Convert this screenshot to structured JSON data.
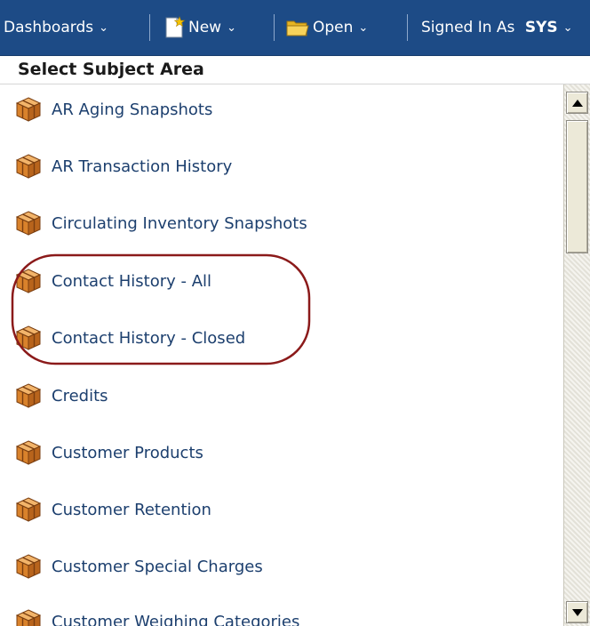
{
  "toolbar": {
    "dashboards_label": "Dashboards",
    "new_label": "New",
    "open_label": "Open",
    "signed_in_label": "Signed In As",
    "user": "SYS"
  },
  "panel": {
    "title": "Select Subject Area"
  },
  "subject_areas": [
    "AR Aging Snapshots",
    "AR Transaction History",
    "Circulating Inventory Snapshots",
    "Contact History - All",
    "Contact History - Closed",
    "Credits",
    "Customer Products",
    "Customer Retention",
    "Customer Special Charges",
    "Customer Weighing Categories"
  ],
  "highlighted_items": [
    "Contact History - All",
    "Contact History - Closed"
  ],
  "colors": {
    "toolbar_bg": "#1d4b86",
    "link_text": "#1c3f6e",
    "annotation": "#8b1a1a"
  },
  "icons": {
    "item": "subject-area-cube-icon",
    "new": "new-document-icon",
    "open": "folder-icon"
  }
}
